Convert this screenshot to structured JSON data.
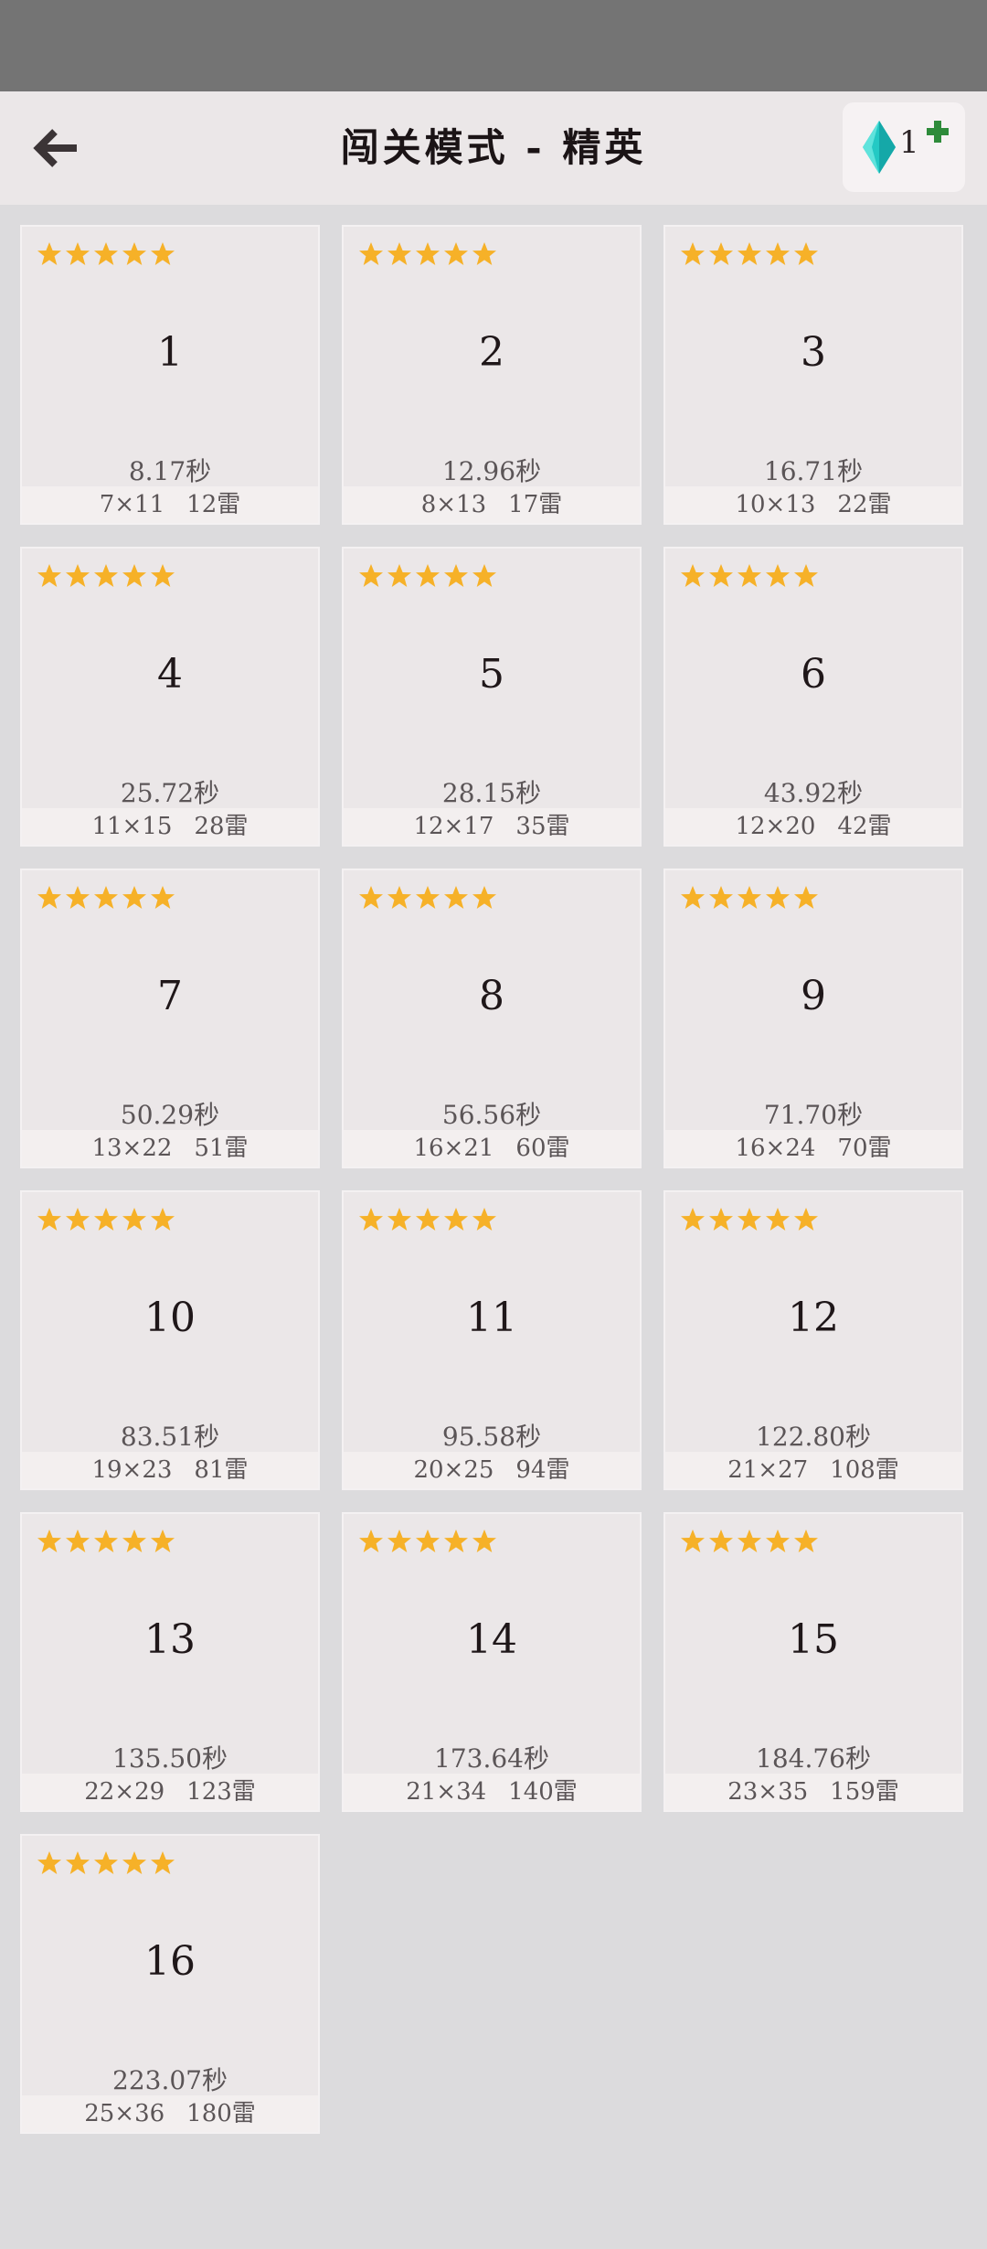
{
  "header": {
    "title": "闯关模式 - 精英",
    "gem_count": "1",
    "icons": {
      "back": "back-arrow-icon",
      "gem": "diamond-gem-icon",
      "plus": "plus-icon",
      "star": "star-icon"
    },
    "colors": {
      "star": "#f6b128",
      "gem": "#23c9c4",
      "plus": "#2e8b3a"
    }
  },
  "levels": [
    {
      "num": "1",
      "stars": 5,
      "time": "8.17秒",
      "size": "7×11",
      "mines": "12雷"
    },
    {
      "num": "2",
      "stars": 5,
      "time": "12.96秒",
      "size": "8×13",
      "mines": "17雷"
    },
    {
      "num": "3",
      "stars": 5,
      "time": "16.71秒",
      "size": "10×13",
      "mines": "22雷"
    },
    {
      "num": "4",
      "stars": 5,
      "time": "25.72秒",
      "size": "11×15",
      "mines": "28雷"
    },
    {
      "num": "5",
      "stars": 5,
      "time": "28.15秒",
      "size": "12×17",
      "mines": "35雷"
    },
    {
      "num": "6",
      "stars": 5,
      "time": "43.92秒",
      "size": "12×20",
      "mines": "42雷"
    },
    {
      "num": "7",
      "stars": 5,
      "time": "50.29秒",
      "size": "13×22",
      "mines": "51雷"
    },
    {
      "num": "8",
      "stars": 5,
      "time": "56.56秒",
      "size": "16×21",
      "mines": "60雷"
    },
    {
      "num": "9",
      "stars": 5,
      "time": "71.70秒",
      "size": "16×24",
      "mines": "70雷"
    },
    {
      "num": "10",
      "stars": 5,
      "time": "83.51秒",
      "size": "19×23",
      "mines": "81雷"
    },
    {
      "num": "11",
      "stars": 5,
      "time": "95.58秒",
      "size": "20×25",
      "mines": "94雷"
    },
    {
      "num": "12",
      "stars": 5,
      "time": "122.80秒",
      "size": "21×27",
      "mines": "108雷"
    },
    {
      "num": "13",
      "stars": 5,
      "time": "135.50秒",
      "size": "22×29",
      "mines": "123雷"
    },
    {
      "num": "14",
      "stars": 5,
      "time": "173.64秒",
      "size": "21×34",
      "mines": "140雷"
    },
    {
      "num": "15",
      "stars": 5,
      "time": "184.76秒",
      "size": "23×35",
      "mines": "159雷"
    },
    {
      "num": "16",
      "stars": 5,
      "time": "223.07秒",
      "size": "25×36",
      "mines": "180雷"
    }
  ]
}
